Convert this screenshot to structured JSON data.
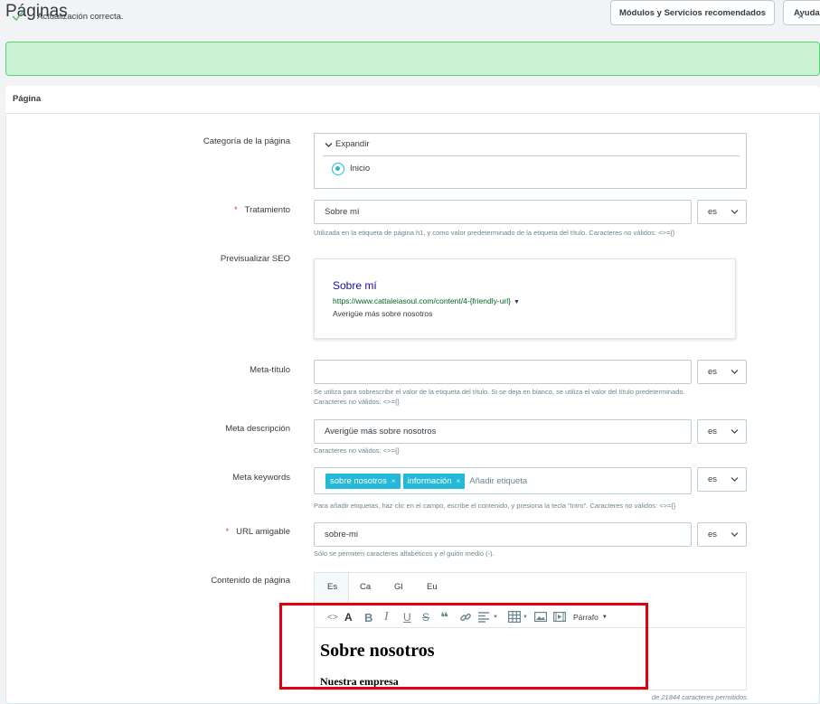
{
  "header": {
    "title": "Páginas",
    "buttons": [
      "Módulos y Servicios recomendados",
      "Ayuda"
    ]
  },
  "alert": {
    "message": "Actualización correcta.",
    "close": "×"
  },
  "panel": {
    "title": "Página"
  },
  "form": {
    "category": {
      "label": "Categoría de la página",
      "expand": "Expandir",
      "option": "Inicio"
    },
    "title_field": {
      "required": "*",
      "label": "Tratamiento",
      "value": "Sobre mí",
      "lang": "es",
      "help": "Utilizada en la etiqueta de página h1, y como valor predeterminado de la etiqueta del título. Caracteres no válidos: <>={}"
    },
    "seo_preview": {
      "label": "Previsualizar SEO",
      "title": "Sobre mí",
      "url": "https://www.cattaleiasoul.com/content/4-{friendly-url}",
      "description": "Averigüe más sobre nosotros"
    },
    "meta_title": {
      "label": "Meta-título",
      "value": "",
      "lang": "es",
      "help1": "Se utiliza para sobrescribir el valor de la etiqueta del título. Si se deja en blanco, se utiliza el valor del título predeterminado.",
      "help2": "Caracteres no válidos: <>={}"
    },
    "meta_description": {
      "label": "Meta descripción",
      "value": "Averigüe más sobre nosotros",
      "lang": "es",
      "help": "Caracteres no válidos: <>={}"
    },
    "meta_keywords": {
      "label": "Meta keywords",
      "tags": [
        "sobre nosotros",
        "información"
      ],
      "tag_remove": "×",
      "placeholder": "Añadir etiqueta",
      "lang": "es",
      "help": "Para añadir etiquetas, haz clic en el campo, escribe el contenido, y presiona la tecla \"Intro\". Caracteres no válidos: <>={}"
    },
    "friendly_url": {
      "required": "*",
      "label": "URL amigable",
      "value": "sobre-mi",
      "lang": "es",
      "help": "Sólo se permiten caracteres alfabéticos y el guión medio (-)."
    },
    "content": {
      "label": "Contenido de página",
      "tabs": [
        "Es",
        "Ca",
        "Gl",
        "Eu"
      ],
      "active_tab": "Es",
      "toolbar_format": "Párrafo",
      "heading": "Sobre nosotros",
      "subheading": "Nuestra empresa",
      "counter": "de 21844 caracteres permitidos"
    }
  },
  "colors": {
    "success_bg": "#cbf2d4",
    "success_border": "#53d572",
    "accent": "#25b9d7",
    "required": "#e03c2d",
    "highlight": "#e3000f"
  }
}
